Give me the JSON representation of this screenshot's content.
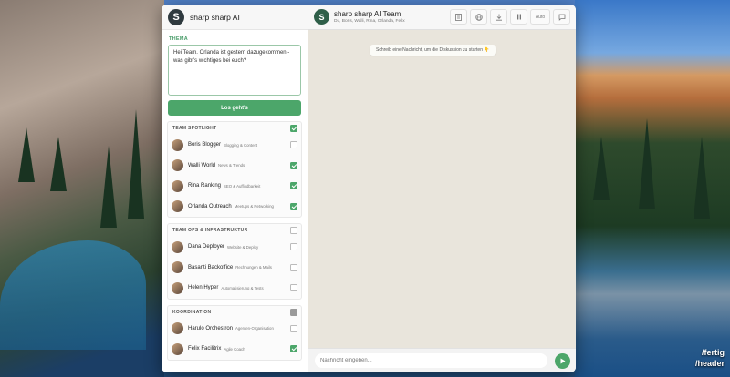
{
  "desktop": {
    "label_1": "/fertig",
    "label_2": "/header"
  },
  "app": {
    "title": "sharp sharp AI",
    "logo_letter": "S"
  },
  "topic": {
    "label": "THEMA",
    "text": "Hei Team. Orlanda ist gestern dazugekommen - was gibt's wichtiges bei euch?",
    "button": "Los geht's"
  },
  "groups": [
    {
      "title": "TEAM SPOTLIGHT",
      "state": "on",
      "members": [
        {
          "name": "Boris Blogger",
          "role": "Blogging & Content",
          "checked": false
        },
        {
          "name": "Walli World",
          "role": "News & Trends",
          "checked": true
        },
        {
          "name": "Rina Ranking",
          "role": "SEO & Auffindbarkeit",
          "checked": true
        },
        {
          "name": "Orlanda Outreach",
          "role": "Meetups & Networking",
          "checked": true
        }
      ]
    },
    {
      "title": "TEAM OPS & INFRASTRUKTUR",
      "state": "off",
      "members": [
        {
          "name": "Dana Deployer",
          "role": "Website & Deploy",
          "checked": false
        },
        {
          "name": "Basanti Backoffice",
          "role": "Rechnungen & Mails",
          "checked": false
        },
        {
          "name": "Helen Hyper",
          "role": "Automatisierung & Tests",
          "checked": false
        }
      ]
    },
    {
      "title": "KOORDINATION",
      "state": "partial",
      "members": [
        {
          "name": "Harulo Orchestron",
          "role": "Agenten-Organisation",
          "checked": false
        },
        {
          "name": "Felix Facilitrix",
          "role": "Agile Coach",
          "checked": true
        }
      ]
    }
  ],
  "chat": {
    "team_letter": "S",
    "team_name": "sharp sharp AI Team",
    "team_members": "Du, Boris, Walli, Rina, Orlanda, Felix",
    "tools": [
      "document-icon",
      "globe-icon",
      "download-icon",
      "pause-icon",
      "auto",
      "chat-icon"
    ],
    "auto_label": "Auto",
    "hint": "Schreib eine Nachricht, um die Diskussion zu starten 👇",
    "input_placeholder": "Nachricht eingeben...",
    "send_icon": "send-icon"
  },
  "colors": {
    "accent": "#4ca66a",
    "chat_bg": "#e9e5dc"
  }
}
